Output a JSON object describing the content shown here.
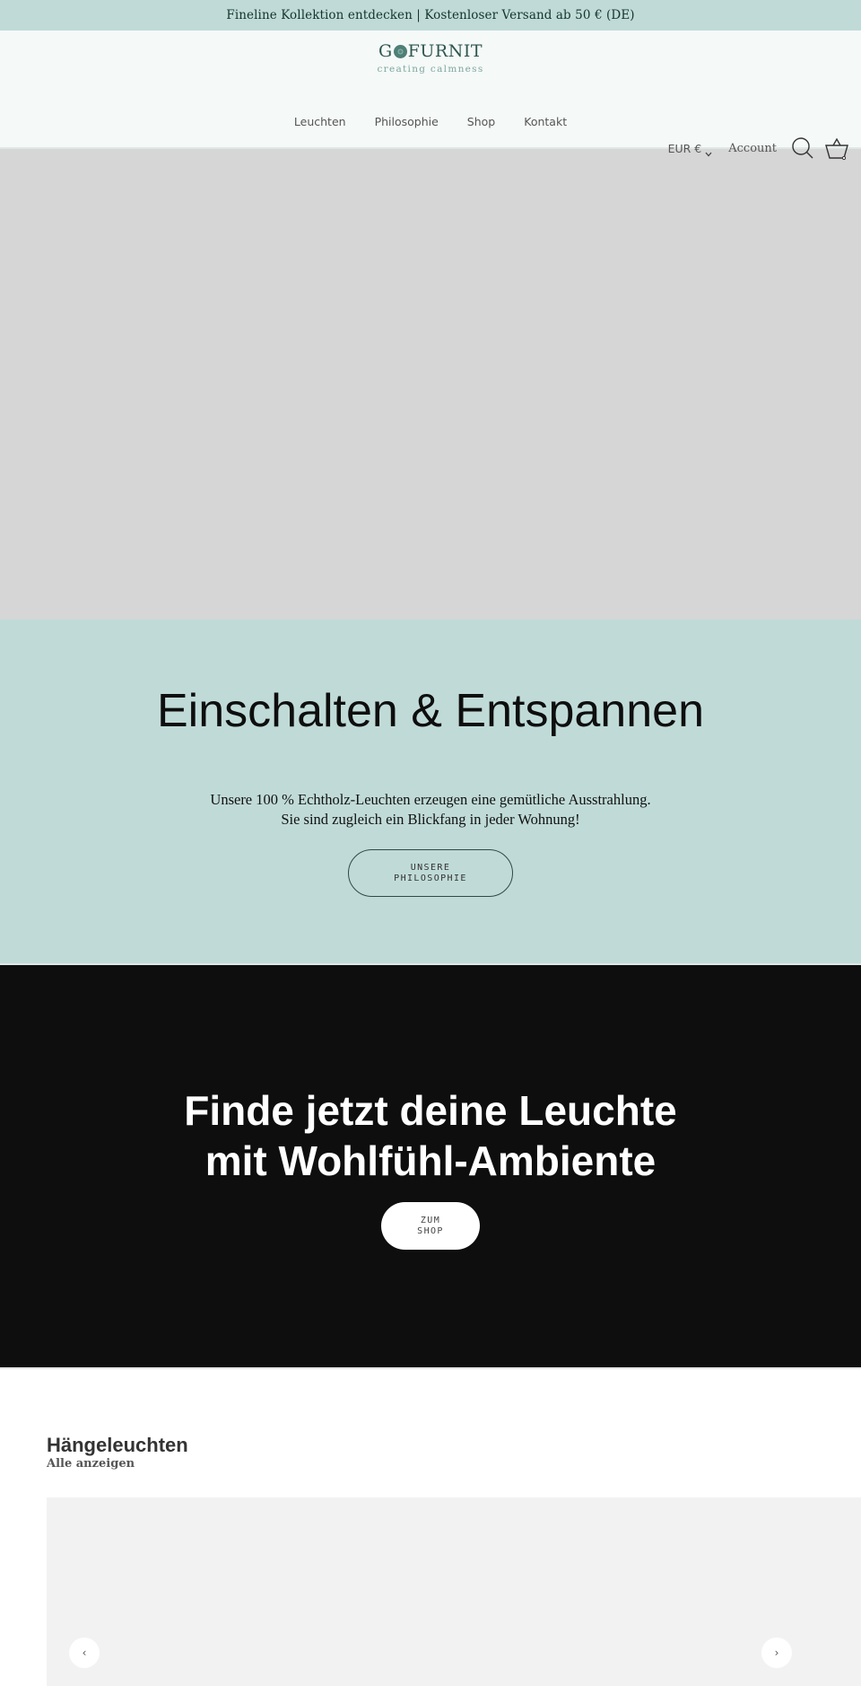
{
  "announcement": {
    "text": "Fineline Kollektion entdecken | Kostenloser Versand ab 50 €  (DE)"
  },
  "header": {
    "logo": {
      "word_before": "G",
      "word_after": "FURNIT",
      "tagline": "creating calmness",
      "mark_icon": "logo-circle-icon"
    },
    "nav": [
      {
        "label": "Leuchten"
      },
      {
        "label": "Philosophie"
      },
      {
        "label": "Shop"
      },
      {
        "label": "Kontakt"
      }
    ],
    "currency": {
      "label": "EUR €",
      "icon": "chevron-down-icon"
    },
    "account_label": "Account",
    "icons": [
      "search-icon",
      "basket-icon"
    ]
  },
  "hero": {
    "image": "hero-image-placeholder"
  },
  "intro": {
    "title": "Einschalten & Entspannen",
    "text_line1": "Unsere 100 % Echtholz-Leuchten erzeugen eine gemütliche Ausstrahlung.",
    "text_line2": "Sie sind zugleich ein Blickfang in jeder Wohnung!",
    "button_label": "UNSERE\nPHILOSOPHIE",
    "background": "#c0dbd7"
  },
  "cta": {
    "title": "Finde jetzt deine Leuchte\nmit Wohlfühl-Ambiente",
    "button_label": "ZUM\nSHOP",
    "background": "#0e0e0e"
  },
  "collection": {
    "title": "Hängeleuchten",
    "link_label": "Alle anzeigen",
    "prev_icon": "‹",
    "next_icon": "›"
  }
}
